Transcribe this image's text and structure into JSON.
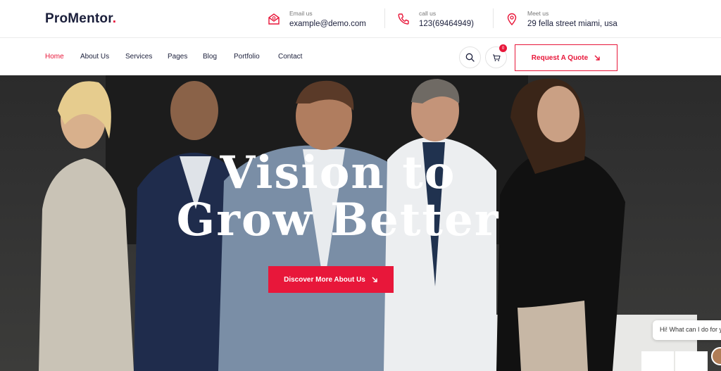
{
  "brand": {
    "name": "ProMentor",
    "dot": ".",
    "accent": "#e8173a",
    "dark": "#1b1f3b"
  },
  "contact": {
    "email": {
      "label": "Email us",
      "value": "example@demo.com",
      "icon": "envelope-icon"
    },
    "call": {
      "label": "call us",
      "value": "123(69464949)",
      "icon": "phone-icon"
    },
    "meet": {
      "label": "Meet us",
      "value": "29 fella street miami, usa",
      "icon": "map-pin-icon"
    }
  },
  "nav": {
    "items": [
      {
        "label": "Home",
        "active": true
      },
      {
        "label": "About Us"
      },
      {
        "label": "Services"
      },
      {
        "label": "Pages"
      },
      {
        "label": "Blog"
      },
      {
        "label": "Portfolio"
      },
      {
        "label": "Contact"
      }
    ],
    "cart_count": "0",
    "quote_label": "Request A Quote"
  },
  "hero": {
    "title_line1": "Vision to",
    "title_line2": "Grow Better",
    "cta_label": "Discover More About Us"
  },
  "chat": {
    "greeting": "Hi! What can I do for you?"
  }
}
